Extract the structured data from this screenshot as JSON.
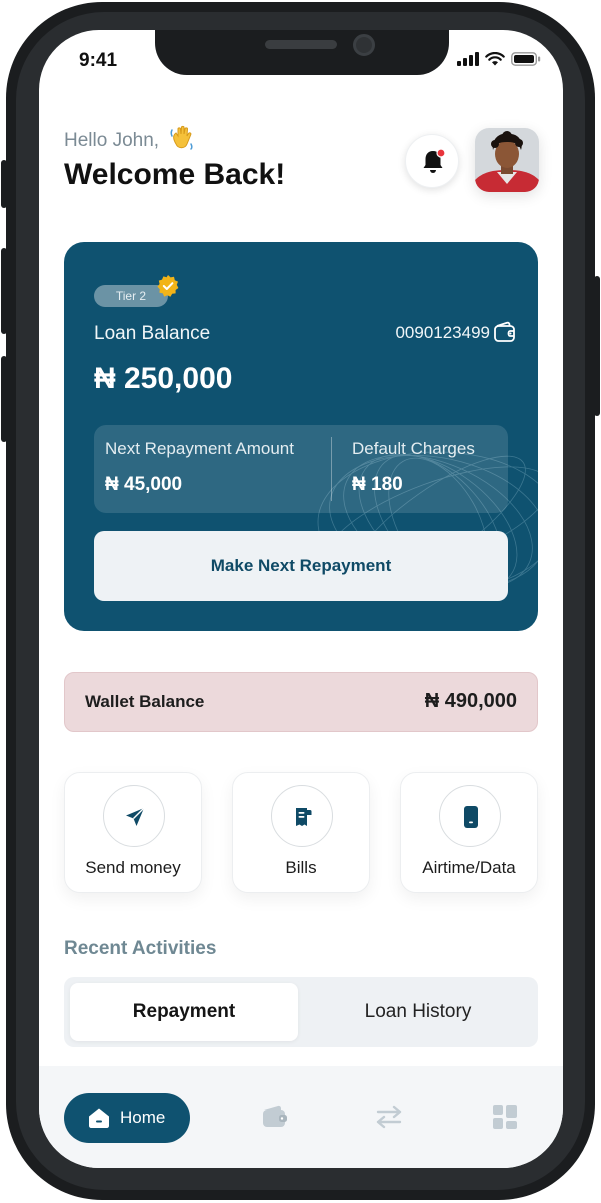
{
  "status_bar": {
    "time": "9:41"
  },
  "header": {
    "greeting": "Hello John,",
    "title": "Welcome Back!"
  },
  "loan_card": {
    "tier": "Tier 2",
    "loan_balance_label": "Loan Balance",
    "account_number": "0090123499",
    "loan_balance": "₦ 250,000",
    "next_repayment_label": "Next Repayment Amount",
    "next_repayment_amount": "₦ 45,000",
    "default_charges_label": "Default Charges",
    "default_charges_amount": "₦ 180",
    "repay_button": "Make Next Repayment"
  },
  "wallet": {
    "label": "Wallet Balance",
    "amount": "₦ 490,000"
  },
  "actions": [
    {
      "label": "Send money",
      "icon": "send-icon"
    },
    {
      "label": "Bills",
      "icon": "bill-icon"
    },
    {
      "label": "Airtime/Data",
      "icon": "phone-icon"
    }
  ],
  "recent": {
    "title": "Recent Activities",
    "tabs": [
      "Repayment",
      "Loan History"
    ],
    "active_tab": 0
  },
  "bottom_nav": {
    "home_label": "Home"
  },
  "colors": {
    "primary": "#0f5270",
    "wallet_bg": "#ecd9db",
    "badge": "#f2b418",
    "notification": "#e8343b"
  }
}
